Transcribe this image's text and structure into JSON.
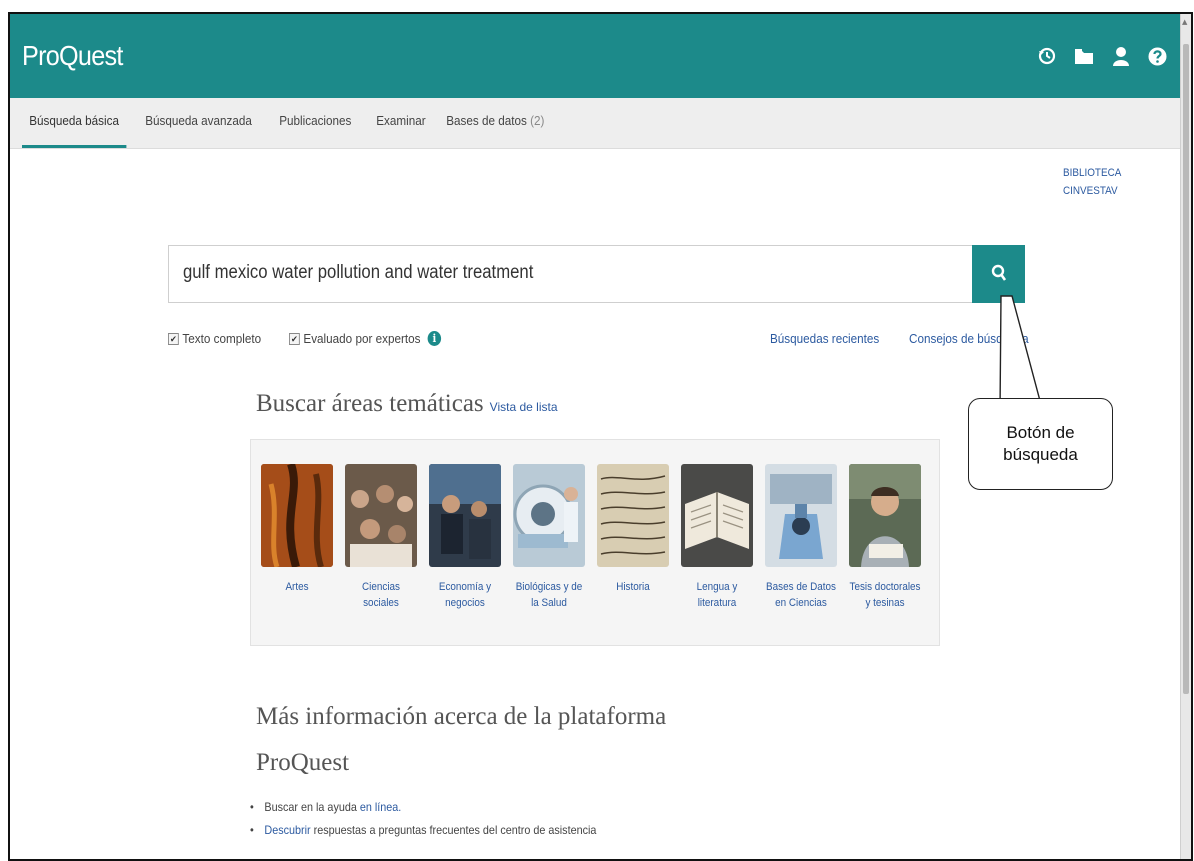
{
  "header": {
    "logo": "ProQuest",
    "icons": [
      "history-icon",
      "folder-icon",
      "user-icon",
      "help-icon"
    ],
    "brand_color": "#1c8a8a"
  },
  "nav": {
    "tabs": [
      {
        "label": "Búsqueda básica",
        "active": true
      },
      {
        "label": "Búsqueda avanzada"
      },
      {
        "label": "Publicaciones"
      },
      {
        "label": "Examinar"
      },
      {
        "label": "Bases de datos",
        "count": "(2)"
      }
    ]
  },
  "library": {
    "line1": "BIBLIOTECA",
    "line2": "CINVESTAV"
  },
  "search": {
    "query": "gulf mexico water pollution and water treatment",
    "full_text_label": "Texto completo",
    "full_text_checked": true,
    "peer_reviewed_label": "Evaluado por expertos",
    "peer_reviewed_checked": true,
    "recent_searches": "Búsquedas recientes",
    "search_tips": "Consejos de búsqueda"
  },
  "subjects": {
    "title": "Buscar áreas temáticas",
    "list_view": "Vista de lista",
    "items": [
      {
        "line1": "Artes",
        "line2": ""
      },
      {
        "line1": "Ciencias",
        "line2": "sociales"
      },
      {
        "line1": "Economía y",
        "line2": "negocios"
      },
      {
        "line1": "Biológicas y de",
        "line2": "la Salud"
      },
      {
        "line1": "Historia",
        "line2": ""
      },
      {
        "line1": "Lengua y",
        "line2": "literatura"
      },
      {
        "line1": "Bases de Datos",
        "line2": "en Ciencias"
      },
      {
        "line1": "Tesis doctorales",
        "line2": "y tesinas"
      }
    ]
  },
  "more": {
    "title_line1": "Más información acerca de la plataforma",
    "title_line2": "ProQuest",
    "help1_prefix": "Buscar en la ayuda ",
    "help1_link": "en línea.",
    "help2_link": "Descubrir",
    "help2_suffix": " respuestas a preguntas frecuentes del centro de asistencia"
  },
  "annotation": {
    "line1": "Botón de",
    "line2": "búsqueda"
  }
}
